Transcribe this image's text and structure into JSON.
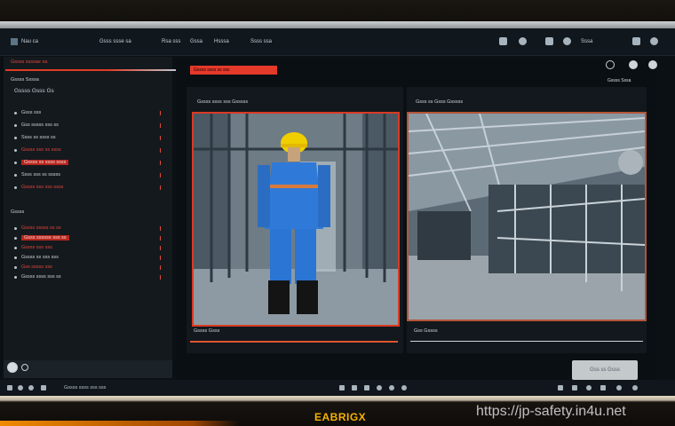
{
  "topbar": {
    "app_title": "Nau ca",
    "breadcrumb": "Gsss ssse sa",
    "menu": [
      "Rsa sss",
      "Gssa",
      "Hsssa",
      "Ssss ssa"
    ],
    "right_label": "Sssa",
    "icons": [
      "gear-icon",
      "user-icon",
      "bell-icon",
      "settings-icon"
    ]
  },
  "sidebar": {
    "section_header": "Gssss ssssae sa",
    "group_title": "Gssss Ssssa",
    "group_sub": "Gssss Gsss Gs",
    "items": [
      {
        "label": "Gsss sss",
        "style": "plain"
      },
      {
        "label": "Gss sssss sss ss",
        "style": "plain"
      },
      {
        "label": "Ssss ss ssss ss",
        "style": "plain"
      },
      {
        "label": "Gssss sss ss ssss",
        "style": "red"
      },
      {
        "label": "Gssss ss ssss ssss",
        "style": "hl"
      },
      {
        "label": "Ssss sss ss sssss",
        "style": "plain"
      },
      {
        "label": "Gssss sss sss ssss",
        "style": "red"
      }
    ],
    "section2_title": "Gssss",
    "section2_items": [
      {
        "label": "Gssss sssss ss ss",
        "style": "red"
      },
      {
        "label": "Gsss ssssse sss ss",
        "style": "hl"
      },
      {
        "label": "Gssss sss sss",
        "style": "red"
      },
      {
        "label": "Gssss ss sss sss",
        "style": "plain"
      },
      {
        "label": "Gss sssss sss",
        "style": "red"
      },
      {
        "label": "Gssss ssss sss ss",
        "style": "plain"
      }
    ]
  },
  "main": {
    "top_label": "Gssss ssss ss sss",
    "right_info": "Gssss Sssa",
    "camera1": {
      "title": "Gssss ssss sss Gsssss",
      "footer": "Gssss Gsss"
    },
    "camera2": {
      "title": "Gsss ss Gsss Gsssss",
      "footer": "Gss Gssss"
    },
    "play_button": "Gss ss Gsss"
  },
  "bottom": {
    "status": "Gssss ssss sss sss"
  },
  "brand": "EABRIGX",
  "watermark": "https://jp-safety.in4u.net",
  "colors": {
    "accent": "#e23c25",
    "sidebar_bg": "#14191e",
    "brand": "#f5b100"
  }
}
